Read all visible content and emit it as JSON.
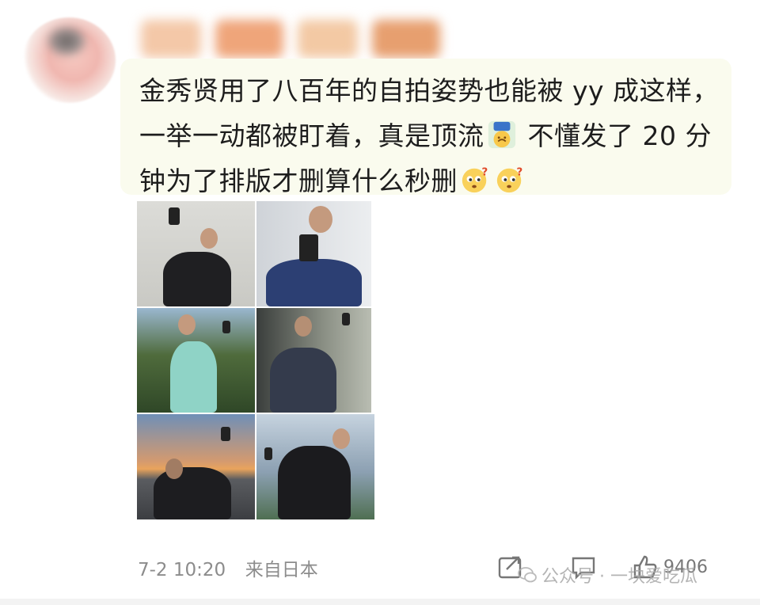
{
  "post": {
    "text_parts": [
      "金秀贤用了八百年的自拍姿势也能被 yy 成这样，一举一动都被盯着，真是顶流",
      " 不懂发了 20 分钟为了排版才删算什么秒删"
    ],
    "emoji_upside_down": "upside-down-face-icon",
    "emoji_confused": "confused-face-icon",
    "timestamp": "7-2 10:20",
    "location": "来自日本"
  },
  "actions": {
    "like_count": "9406"
  },
  "watermark": {
    "text": "公众号 · 一块爱吃瓜"
  },
  "colors": {
    "bubble_bg": "#fafbee",
    "text": "#1d1d1d",
    "meta": "#8c8c8c"
  }
}
